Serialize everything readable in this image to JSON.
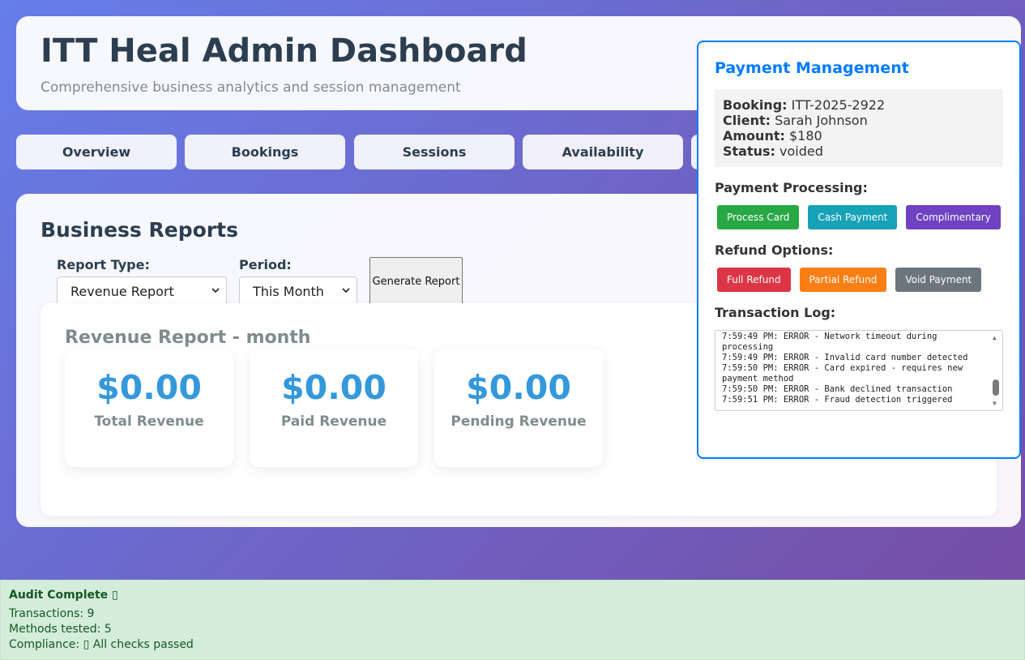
{
  "header": {
    "title": "ITT Heal Admin Dashboard",
    "subtitle": "Comprehensive business analytics and session management"
  },
  "tabs": [
    "Overview",
    "Bookings",
    "Sessions",
    "Availability",
    ""
  ],
  "reports": {
    "title": "Business Reports",
    "report_type_label": "Report Type:",
    "report_type_value": "Revenue Report",
    "period_label": "Period:",
    "period_value": "This Month",
    "generate_label": "Generate Report",
    "report_title": "Revenue Report - month",
    "stats": [
      {
        "value": "$0.00",
        "label": "Total Revenue"
      },
      {
        "value": "$0.00",
        "label": "Paid Revenue"
      },
      {
        "value": "$0.00",
        "label": "Pending Revenue"
      }
    ]
  },
  "payment": {
    "title": "Payment Management",
    "booking_label": "Booking:",
    "booking_value": "ITT-2025-2922",
    "client_label": "Client:",
    "client_value": "Sarah Johnson",
    "amount_label": "Amount:",
    "amount_value": "$180",
    "status_label": "Status:",
    "status_value": "voided",
    "processing_title": "Payment Processing:",
    "process_card": "Process Card",
    "cash_payment": "Cash Payment",
    "complimentary": "Complimentary",
    "refund_title": "Refund Options:",
    "full_refund": "Full Refund",
    "partial_refund": "Partial Refund",
    "void_payment": "Void Payment",
    "log_title": "Transaction Log:",
    "log": [
      "7:59:49 PM: ERROR - Network timeout during processing",
      "7:59:49 PM: ERROR - Invalid card number detected",
      "7:59:50 PM: ERROR - Card expired - requires new payment method",
      "7:59:50 PM: ERROR - Bank declined transaction",
      "7:59:51 PM: ERROR - Fraud detection triggered"
    ],
    "colors": {
      "process": "#28a745",
      "cash": "#17a2b8",
      "comp": "#6f42c1",
      "full": "#dc3545",
      "partial": "#fd7e14",
      "void": "#6c757d"
    }
  },
  "audit": {
    "title": "Audit Complete ▯",
    "transactions": "Transactions: 9",
    "methods": "Methods tested: 5",
    "compliance": "Compliance: ▯ All checks passed"
  }
}
